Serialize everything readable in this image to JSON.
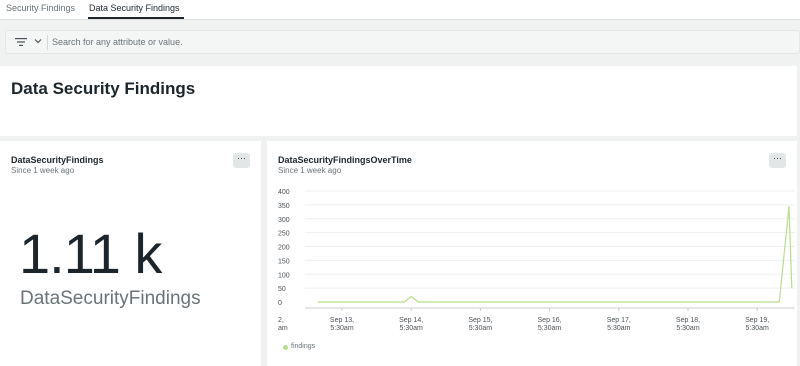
{
  "tabs": [
    {
      "label": "Security Findings"
    },
    {
      "label": "Data Security Findings"
    }
  ],
  "filter_bar": {
    "search_placeholder": "Search for any attribute or value."
  },
  "page": {
    "title": "Data Security Findings"
  },
  "billboard": {
    "title": "DataSecurityFindings",
    "subtitle": "Since 1 week ago",
    "value": "1.11 k",
    "label": "DataSecurityFindings",
    "menu_label": "···"
  },
  "timeseries": {
    "title": "DataSecurityFindingsOverTime",
    "subtitle": "Since 1 week ago",
    "menu_label": "···",
    "legend": "findings",
    "line_color": "#b6de8a",
    "first_tick_fragment": [
      "2,",
      "am"
    ]
  },
  "chart_data": {
    "type": "line",
    "title": "DataSecurityFindingsOverTime",
    "ylim": [
      0,
      400
    ],
    "y_ticks": [
      0,
      50,
      100,
      150,
      200,
      250,
      300,
      350,
      400
    ],
    "x_tick_labels": [
      [
        "Sep 13,",
        "5:30am"
      ],
      [
        "Sep 14,",
        "5:30am"
      ],
      [
        "Sep 15,",
        "5:30am"
      ],
      [
        "Sep 16,",
        "5:30am"
      ],
      [
        "Sep 17,",
        "5:30am"
      ],
      [
        "Sep 18,",
        "5:30am"
      ],
      [
        "Sep 19,",
        "5:30am"
      ]
    ],
    "series": [
      {
        "name": "findings",
        "x": [
          -0.35,
          0.0,
          0.9,
          1.0,
          1.1,
          2.0,
          3.0,
          4.0,
          5.0,
          6.0,
          6.25,
          6.32,
          6.4,
          6.46,
          6.5
        ],
        "values": [
          0,
          0,
          0,
          20,
          0,
          0,
          0,
          0,
          0,
          0,
          0,
          0,
          200,
          345,
          50
        ]
      }
    ],
    "grid": true,
    "legend_position": "bottom-left"
  }
}
